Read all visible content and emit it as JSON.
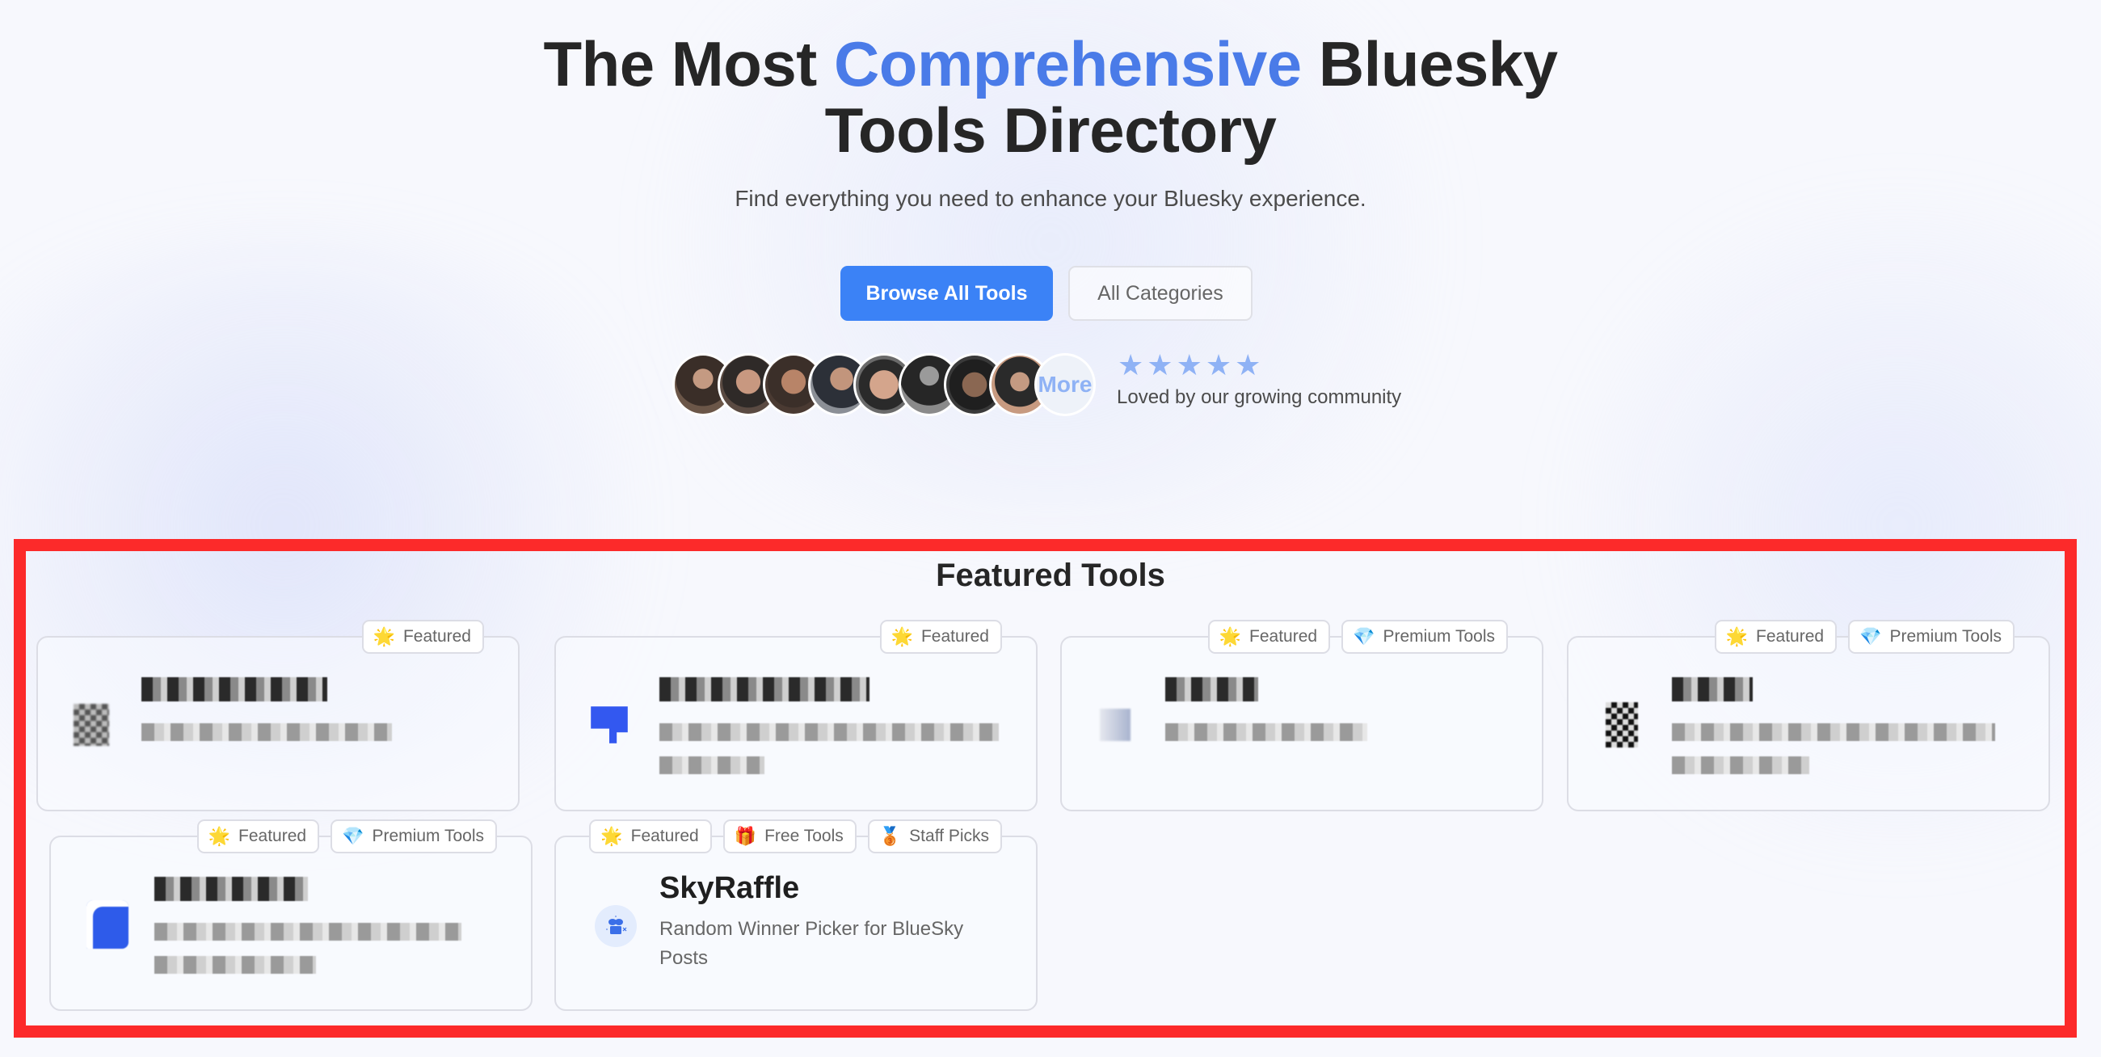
{
  "hero": {
    "title_before": "The Most ",
    "title_accent": "Comprehensive",
    "title_after": " Bluesky",
    "title_line2": "Tools Directory",
    "subtitle": "Find everything you need to enhance your Bluesky experience.",
    "accent_color": "#4a7be8"
  },
  "actions": {
    "browse_label": "Browse All Tools",
    "categories_label": "All Categories"
  },
  "community": {
    "avatars": [
      {
        "name": "avatar-1",
        "color": "#5b4a3f"
      },
      {
        "name": "avatar-2",
        "color": "#6e5448"
      },
      {
        "name": "avatar-3",
        "color": "#7a5a4c"
      },
      {
        "name": "avatar-4",
        "color": "#5d6470"
      },
      {
        "name": "avatar-5",
        "color": "#8a6a5a"
      },
      {
        "name": "avatar-6",
        "color": "#4d4d4d"
      },
      {
        "name": "avatar-7",
        "color": "#3d3a38"
      },
      {
        "name": "avatar-8",
        "color": "#6a5a52"
      }
    ],
    "more_label": "More",
    "rating_stars": 5,
    "tagline": "Loved by our growing community"
  },
  "featured": {
    "title": "Featured Tools",
    "badge_types": {
      "featured": {
        "label": "Featured",
        "icon": "star-icon"
      },
      "premium": {
        "label": "Premium Tools",
        "icon": "diamond-icon"
      },
      "free": {
        "label": "Free Tools",
        "icon": "gift-icon"
      },
      "staff": {
        "label": "Staff Picks",
        "icon": "medal-icon"
      }
    },
    "tools": [
      {
        "name": "[blurred]",
        "description": "[blurred]",
        "blurred": true,
        "badges": [
          "Featured"
        ]
      },
      {
        "name": "[blurred]",
        "description": "[blurred]",
        "blurred": true,
        "badges": [
          "Featured"
        ]
      },
      {
        "name": "[blurred]",
        "description": "[blurred]",
        "blurred": true,
        "badges": [
          "Featured",
          "Premium Tools"
        ]
      },
      {
        "name": "[blurred]",
        "description": "[blurred]",
        "blurred": true,
        "badges": [
          "Featured",
          "Premium Tools"
        ]
      },
      {
        "name": "[blurred]",
        "description": "[blurred]",
        "blurred": true,
        "badges": [
          "Featured",
          "Premium Tools"
        ]
      },
      {
        "name": "SkyRaffle",
        "description": "Random Winner Picker for BlueSky Posts",
        "blurred": false,
        "badges": [
          "Featured",
          "Free Tools",
          "Staff Picks"
        ]
      }
    ]
  }
}
